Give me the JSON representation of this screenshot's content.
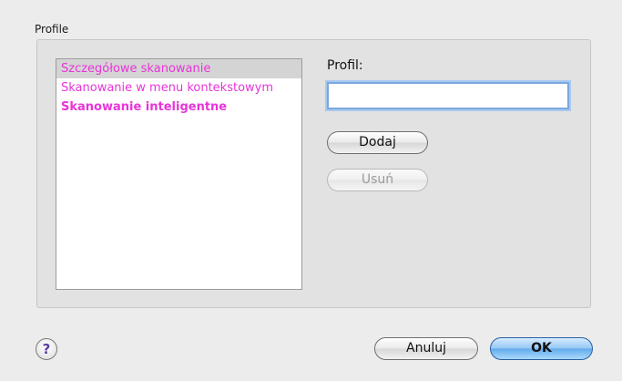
{
  "group": {
    "title": "Profile"
  },
  "profiles": [
    {
      "label": "Szczegółowe skanowanie"
    },
    {
      "label": "Skanowanie w menu kontekstowym"
    },
    {
      "label": "Skanowanie inteligentne"
    }
  ],
  "form": {
    "profil_label": "Profil:",
    "profil_value": "",
    "add_label": "Dodaj",
    "remove_label": "Usuń"
  },
  "footer": {
    "help_label": "?",
    "cancel_label": "Anuluj",
    "ok_label": "OK"
  },
  "colors": {
    "list_text": "#e834d8",
    "default_button": "#62a9ea"
  }
}
